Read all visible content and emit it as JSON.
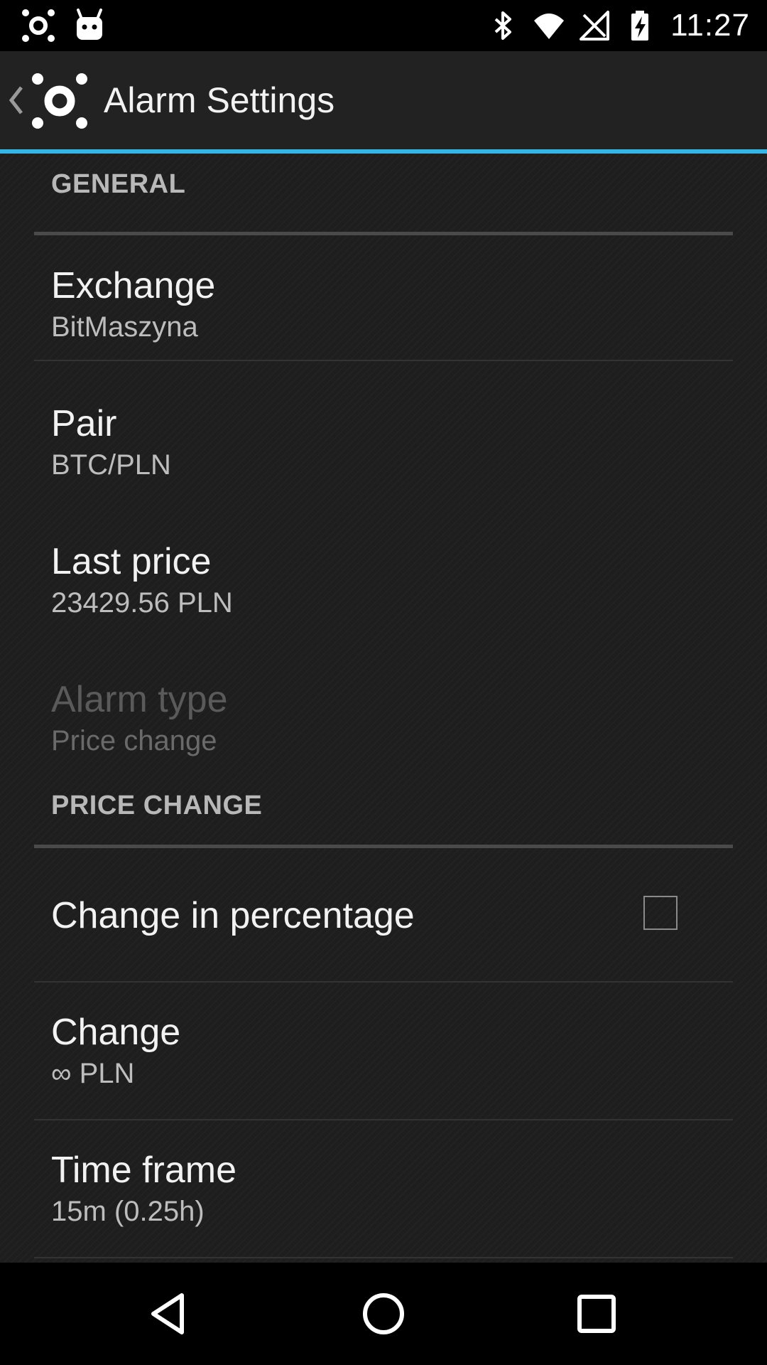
{
  "status_bar": {
    "time": "11:27",
    "left_icons": [
      "app-logo-icon",
      "android-icon"
    ],
    "right_icons": [
      "bluetooth-icon",
      "wifi-icon",
      "signal-icon",
      "battery-charging-icon"
    ]
  },
  "action_bar": {
    "title": "Alarm Settings",
    "accent_color": "#33b5e5"
  },
  "categories": {
    "general": "GENERAL",
    "price_change": "PRICE CHANGE"
  },
  "prefs": {
    "exchange": {
      "title": "Exchange",
      "summary": "BitMaszyna"
    },
    "pair": {
      "title": "Pair",
      "summary": "BTC/PLN"
    },
    "last_price": {
      "title": "Last price",
      "summary": "23429.56 PLN"
    },
    "alarm_type": {
      "title": "Alarm type",
      "summary": "Price change",
      "enabled": false
    },
    "change_in_percentage": {
      "title": "Change in percentage",
      "checked": false
    },
    "change": {
      "title": "Change",
      "summary": "∞ PLN"
    },
    "time_frame": {
      "title": "Time frame",
      "summary": "15m (0.25h)"
    }
  },
  "nav_bar": {
    "buttons": [
      "back-icon",
      "home-icon",
      "recents-icon"
    ]
  }
}
